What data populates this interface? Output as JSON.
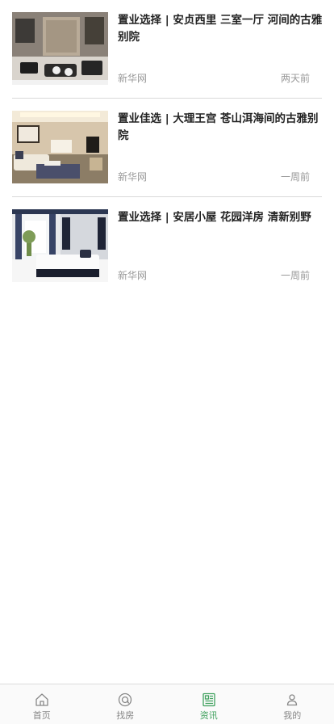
{
  "news": [
    {
      "title": "置业选择 | 安贞西里 三室一厅 河间的古雅别院",
      "source": "新华网",
      "time": "两天前",
      "image": "living-room-photo"
    },
    {
      "title": "置业佳选 | 大理王宫 苍山洱海间的古雅别院",
      "source": "新华网",
      "time": "一周前",
      "image": "living-room-photo"
    },
    {
      "title": "置业选择 | 安居小屋 花园洋房 清新别野",
      "source": "新华网",
      "time": "一周前",
      "image": "bedroom-photo"
    }
  ],
  "tabbar": {
    "items": [
      {
        "label": "首页",
        "icon": "home-icon"
      },
      {
        "label": "找房",
        "icon": "search-icon"
      },
      {
        "label": "资讯",
        "icon": "news-icon"
      },
      {
        "label": "我的",
        "icon": "user-icon"
      }
    ],
    "active_color": "#3fa15d",
    "inactive_color": "#888888"
  }
}
